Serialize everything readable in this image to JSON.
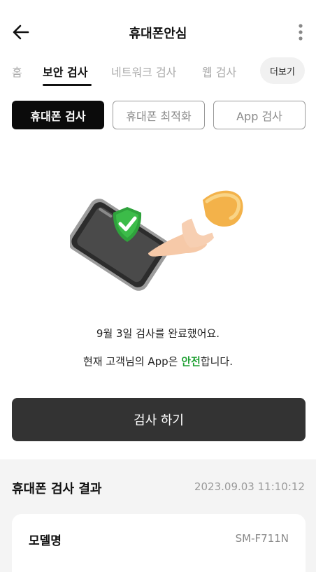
{
  "header": {
    "title": "휴대폰안심"
  },
  "tabs": [
    {
      "label": "홈",
      "active": false
    },
    {
      "label": "보안 검사",
      "active": true
    },
    {
      "label": "네트워크 검사",
      "active": false
    },
    {
      "label": "웹 검사",
      "active": false
    }
  ],
  "tab_more_label": "더보기",
  "scan_types": [
    {
      "label": "휴대폰 검사",
      "selected": true
    },
    {
      "label": "휴대폰 최적화",
      "selected": false
    },
    {
      "label": "App 검사",
      "selected": false
    }
  ],
  "status": {
    "line1": "9월 3일 검사를 완료했어요.",
    "line2_prefix": "현재 고객님의 App은 ",
    "line2_safe": "안전",
    "line2_suffix": "합니다."
  },
  "scan_button_label": "검사 하기",
  "results": {
    "title": "휴대폰 검사 결과",
    "timestamp": "2023.09.03 11:10:12",
    "model_label": "모델명",
    "model_value": "SM-F711N"
  },
  "colors": {
    "safe": "#21a135",
    "primary_button": "#333333",
    "selected_chip": "#0b0b0b"
  },
  "icons": {
    "back": "arrow-left-icon",
    "more": "kebab-menu-icon",
    "illustration": "phone-shield-check-illustration"
  }
}
